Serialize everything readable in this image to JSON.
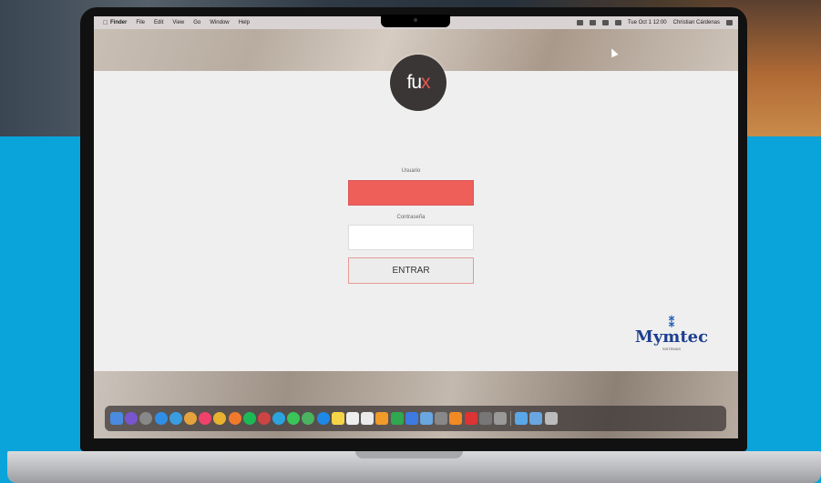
{
  "menubar": {
    "apple_icon": "",
    "app_name": "Finder",
    "items": [
      "File",
      "Edit",
      "View",
      "Go",
      "Window",
      "Help"
    ],
    "user": "Christian Cárdenas",
    "clock": "Tue Oct 1  12:00"
  },
  "app": {
    "logo_text": "fu",
    "logo_accent": "x",
    "username_label": "Usuario",
    "username_value": "",
    "password_label": "Contraseña",
    "password_value": "",
    "submit_label": "ENTRAR"
  },
  "brand": {
    "mark": "⁑",
    "name": "Mymtec",
    "tagline": "SISTEMAS"
  },
  "colors": {
    "accent": "#ee5f5a",
    "backdrop": "#0aa3da",
    "logo_bg": "#3a3636"
  },
  "dock": {
    "icons": [
      "finder-icon",
      "siri-icon",
      "launchpad-icon",
      "safari-icon",
      "mail-icon",
      "photos-icon",
      "music-icon",
      "chrome-icon",
      "firefox-icon",
      "spotify-icon",
      "app-icon",
      "telegram-icon",
      "messages-icon",
      "maps-icon",
      "app-store-icon",
      "notes-icon",
      "calendar-icon",
      "reminders-icon",
      "pages-icon",
      "numbers-icon",
      "keynote-icon",
      "preview-icon",
      "system-preferences-icon",
      "vlc-icon",
      "app-icon-2",
      "app-icon-3",
      "app-icon-4",
      "downloads-icon",
      "folder-icon",
      "trash-icon"
    ],
    "colors": [
      "#4a8be0",
      "#7a55d0",
      "#888",
      "#2f8fe6",
      "#3a9de0",
      "#e6a23c",
      "#f0426b",
      "#e8b22e",
      "#f07a2b",
      "#1db954",
      "#c44",
      "#2aa3de",
      "#3ac45a",
      "#4ab35f",
      "#1e88e5",
      "#f5d547",
      "#eeeeee",
      "#eaeaea",
      "#f09a2a",
      "#2fa84f",
      "#3e7be0",
      "#6aa6e0",
      "#888",
      "#f08a24",
      "#d33",
      "#777",
      "#999",
      "#5aa7e8",
      "#6aa6e0",
      "#bbb"
    ]
  }
}
